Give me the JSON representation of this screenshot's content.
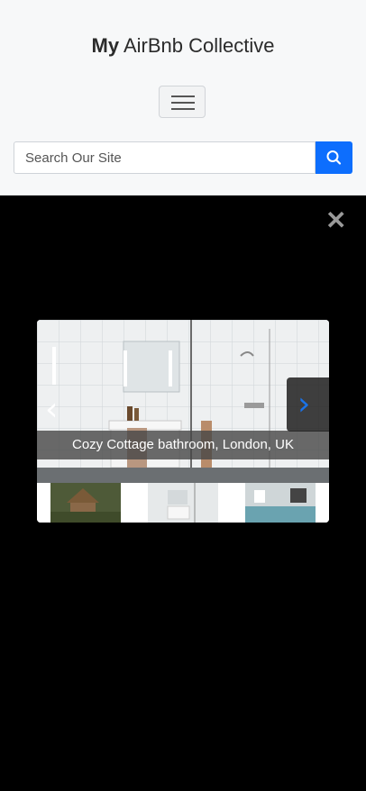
{
  "header": {
    "brand_bold": "My",
    "brand_rest": "AirBnb Collective",
    "search_placeholder": "Search Our Site"
  },
  "lightbox": {
    "caption": "Cozy Cottage bathroom, London, UK",
    "prev_glyph": "‹",
    "next_glyph": "›",
    "close_glyph": "✕",
    "thumbnails": [
      "cottage exterior",
      "bathroom",
      "kitchen"
    ]
  },
  "colors": {
    "accent": "#0d6efd",
    "next_arrow": "#1a73e8",
    "overlay": "#000000"
  }
}
